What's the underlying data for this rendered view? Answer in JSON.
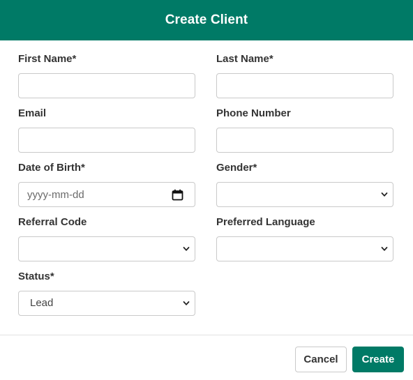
{
  "dialog": {
    "title": "Create Client"
  },
  "fields": {
    "first_name": {
      "label": "First Name*",
      "value": ""
    },
    "last_name": {
      "label": "Last Name*",
      "value": ""
    },
    "email": {
      "label": "Email",
      "value": ""
    },
    "phone": {
      "label": "Phone Number",
      "value": ""
    },
    "dob": {
      "label": "Date of Birth*",
      "placeholder": "yyyy-mm-dd",
      "icon": "calendar-icon"
    },
    "gender": {
      "label": "Gender*",
      "selected": "",
      "icon": "chevron-down-icon"
    },
    "referral_code": {
      "label": "Referral Code",
      "selected": "",
      "icon": "chevron-down-icon"
    },
    "preferred_language": {
      "label": "Preferred Language",
      "selected": "",
      "icon": "chevron-down-icon"
    },
    "status": {
      "label": "Status*",
      "selected": "Lead",
      "icon": "chevron-down-icon"
    }
  },
  "footer": {
    "cancel_label": "Cancel",
    "create_label": "Create"
  },
  "colors": {
    "brand": "#007a66",
    "border": "#c9c9c9",
    "text": "#333333"
  }
}
